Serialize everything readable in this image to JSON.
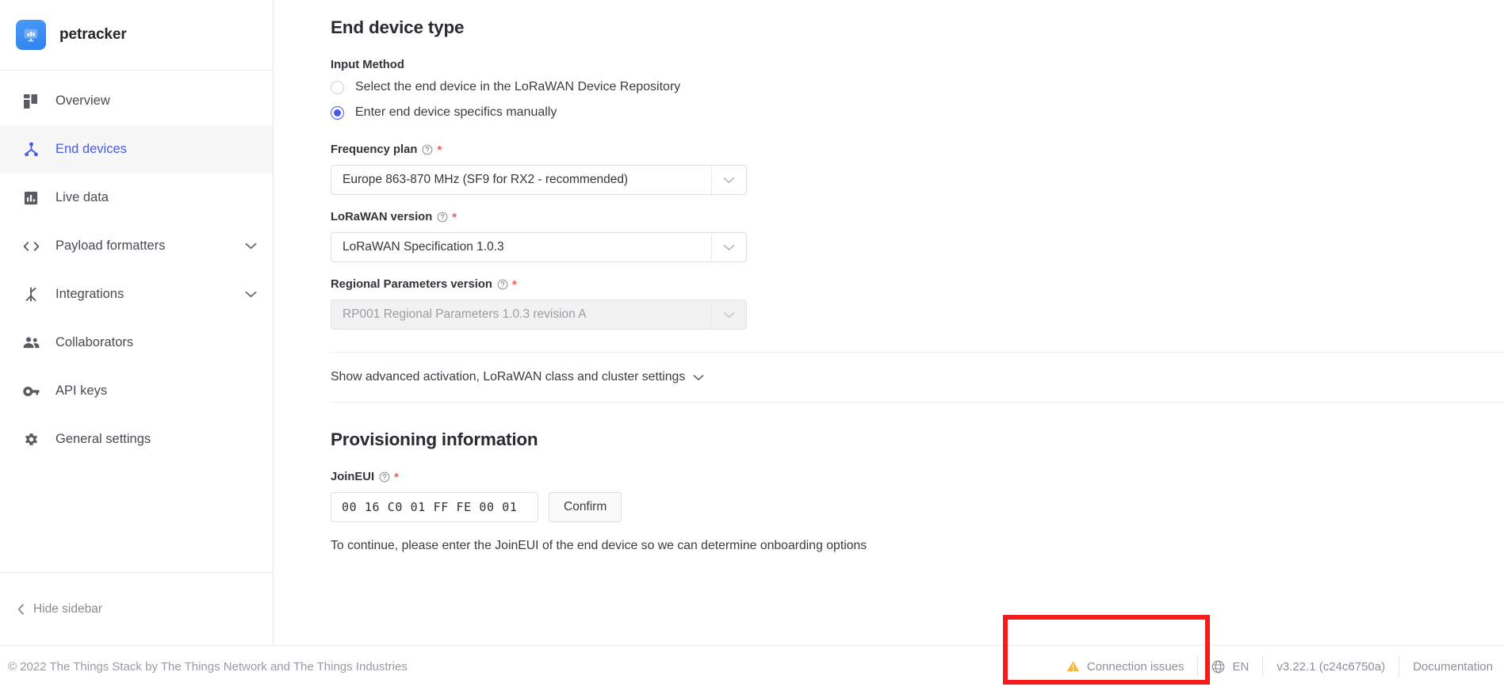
{
  "sidebar": {
    "brand": {
      "name": "petracker",
      "logo_icon": "bar-chart-monitor-icon"
    },
    "items": [
      {
        "label": "Overview",
        "icon": "dashboard-grid-icon",
        "active": false,
        "expandable": false
      },
      {
        "label": "End devices",
        "icon": "device-node-icon",
        "active": true,
        "expandable": false
      },
      {
        "label": "Live data",
        "icon": "bar-chart-icon",
        "active": false,
        "expandable": false
      },
      {
        "label": "Payload formatters",
        "icon": "code-brackets-icon",
        "active": false,
        "expandable": true
      },
      {
        "label": "Integrations",
        "icon": "integrations-branch-icon",
        "active": false,
        "expandable": true
      },
      {
        "label": "Collaborators",
        "icon": "people-icon",
        "active": false,
        "expandable": false
      },
      {
        "label": "API keys",
        "icon": "key-icon",
        "active": false,
        "expandable": false
      },
      {
        "label": "General settings",
        "icon": "gear-icon",
        "active": false,
        "expandable": false
      }
    ],
    "hide_sidebar_label": "Hide sidebar",
    "active_color": "#4659ea",
    "active_bg": "#f7f7f8"
  },
  "main": {
    "section1_title": "End device type",
    "input_method": {
      "label": "Input Method",
      "options": [
        {
          "label": "Select the end device in the LoRaWAN Device Repository",
          "selected": false
        },
        {
          "label": "Enter end device specifics manually",
          "selected": true
        }
      ]
    },
    "frequency_plan": {
      "label": "Frequency plan",
      "required_marker": "*",
      "value": "Europe 863-870 MHz (SF9 for RX2 - recommended)",
      "disabled": false
    },
    "lorawan_version": {
      "label": "LoRaWAN version",
      "required_marker": "*",
      "value": "LoRaWAN Specification 1.0.3",
      "disabled": false
    },
    "regional_parameters": {
      "label": "Regional Parameters version",
      "required_marker": "*",
      "value": "RP001 Regional Parameters 1.0.3 revision A",
      "disabled": true
    },
    "advanced_toggle_label": "Show advanced activation, LoRaWAN class and cluster settings",
    "section2_title": "Provisioning information",
    "join_eui": {
      "label": "JoinEUI",
      "required_marker": "*",
      "value": "00 16 C0 01 FF FE 00 01",
      "confirm_label": "Confirm"
    },
    "hint": "To continue, please enter the JoinEUI of the end device so we can determine onboarding options"
  },
  "footer": {
    "copyright": "© 2022 The Things Stack by The Things Network and The Things Industries",
    "connection_status": "Connection issues",
    "connection_icon": "warning-triangle-icon",
    "connection_icon_color": "#f5b445",
    "language": "EN",
    "language_icon": "globe-icon",
    "version": "v3.22.1 (c24c6750a)",
    "documentation_label": "Documentation"
  },
  "annotation": {
    "highlight_color": "#f41c1c",
    "target": "connection-issues-status"
  }
}
